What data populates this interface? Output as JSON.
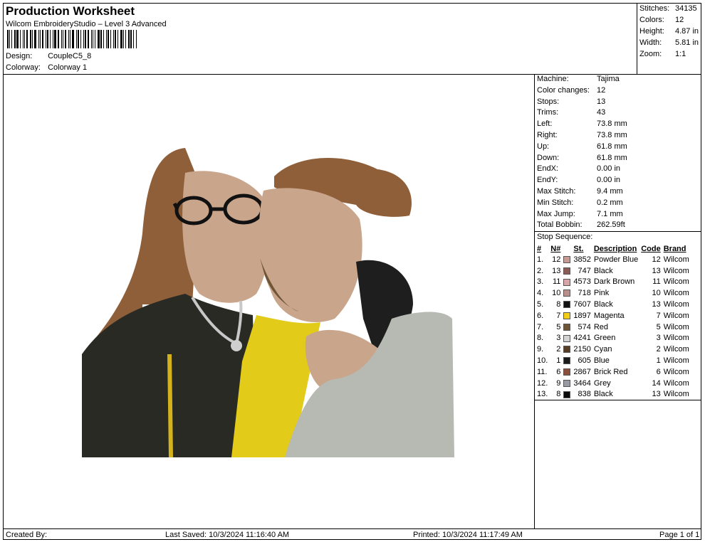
{
  "header": {
    "title": "Production Worksheet",
    "subtitle": "Wilcom EmbroideryStudio – Level 3 Advanced",
    "design_label": "Design:",
    "design_value": "CoupleC5_8",
    "colorway_label": "Colorway:",
    "colorway_value": "Colorway 1"
  },
  "summary": [
    {
      "label": "Stitches:",
      "value": "34135"
    },
    {
      "label": "Colors:",
      "value": "12"
    },
    {
      "label": "Height:",
      "value": "4.87 in"
    },
    {
      "label": "Width:",
      "value": "5.81 in"
    },
    {
      "label": "Zoom:",
      "value": "1:1"
    }
  ],
  "machine_stats": [
    {
      "label": "Machine:",
      "value": "Tajima"
    },
    {
      "label": "Color changes:",
      "value": "12"
    },
    {
      "label": "Stops:",
      "value": "13"
    },
    {
      "label": "Trims:",
      "value": "43"
    },
    {
      "label": "Left:",
      "value": "73.8 mm"
    },
    {
      "label": "Right:",
      "value": "73.8 mm"
    },
    {
      "label": "Up:",
      "value": "61.8 mm"
    },
    {
      "label": "Down:",
      "value": "61.8 mm"
    },
    {
      "label": "EndX:",
      "value": "0.00 in"
    },
    {
      "label": "EndY:",
      "value": "0.00 in"
    },
    {
      "label": "Max Stitch:",
      "value": "9.4 mm"
    },
    {
      "label": "Min Stitch:",
      "value": "0.2 mm"
    },
    {
      "label": "Max Jump:",
      "value": "7.1 mm"
    },
    {
      "label": "Total Bobbin:",
      "value": "262.59ft"
    }
  ],
  "stop_sequence": {
    "label": "Stop Sequence:",
    "headers": [
      "#",
      "N#",
      "St.",
      "Description",
      "Code",
      "Brand"
    ],
    "rows": [
      {
        "num": "1.",
        "n": "12",
        "color": "#c79a93",
        "st": "3852",
        "desc": "Powder Blue",
        "code": "12",
        "brand": "Wilcom"
      },
      {
        "num": "2.",
        "n": "13",
        "color": "#8a5c55",
        "st": "747",
        "desc": "Black",
        "code": "13",
        "brand": "Wilcom"
      },
      {
        "num": "3.",
        "n": "11",
        "color": "#d8a6a8",
        "st": "4573",
        "desc": "Dark Brown",
        "code": "11",
        "brand": "Wilcom"
      },
      {
        "num": "4.",
        "n": "10",
        "color": "#b98f8c",
        "st": "718",
        "desc": "Pink",
        "code": "10",
        "brand": "Wilcom"
      },
      {
        "num": "5.",
        "n": "8",
        "color": "#111111",
        "st": "7607",
        "desc": "Black",
        "code": "13",
        "brand": "Wilcom"
      },
      {
        "num": "6.",
        "n": "7",
        "color": "#f2cf16",
        "st": "1897",
        "desc": "Magenta",
        "code": "7",
        "brand": "Wilcom"
      },
      {
        "num": "7.",
        "n": "5",
        "color": "#6e5535",
        "st": "574",
        "desc": "Red",
        "code": "5",
        "brand": "Wilcom"
      },
      {
        "num": "8.",
        "n": "3",
        "color": "#d3d3d3",
        "st": "4241",
        "desc": "Green",
        "code": "3",
        "brand": "Wilcom"
      },
      {
        "num": "9.",
        "n": "2",
        "color": "#5a3d25",
        "st": "2150",
        "desc": "Cyan",
        "code": "2",
        "brand": "Wilcom"
      },
      {
        "num": "10.",
        "n": "1",
        "color": "#1a1a1a",
        "st": "605",
        "desc": "Blue",
        "code": "1",
        "brand": "Wilcom"
      },
      {
        "num": "11.",
        "n": "6",
        "color": "#8b4f3c",
        "st": "2867",
        "desc": "Brick Red",
        "code": "6",
        "brand": "Wilcom"
      },
      {
        "num": "12.",
        "n": "9",
        "color": "#9a9aa4",
        "st": "3464",
        "desc": "Grey",
        "code": "14",
        "brand": "Wilcom"
      },
      {
        "num": "13.",
        "n": "8",
        "color": "#0a0a0a",
        "st": "838",
        "desc": "Black",
        "code": "13",
        "brand": "Wilcom"
      }
    ]
  },
  "footer": {
    "created_by": "Created By:",
    "last_saved": "Last Saved: 10/3/2024 11:16:40 AM",
    "printed": "Printed: 10/3/2024 11:17:49 AM",
    "page": "Page 1 of 1"
  },
  "palette": {
    "hair_brown": "#8f5f3a",
    "skin": "#c9a58c",
    "jacket_black": "#2a2a24",
    "shirt_yellow": "#e3cb1a",
    "sweater_grey": "#b7bab3"
  }
}
